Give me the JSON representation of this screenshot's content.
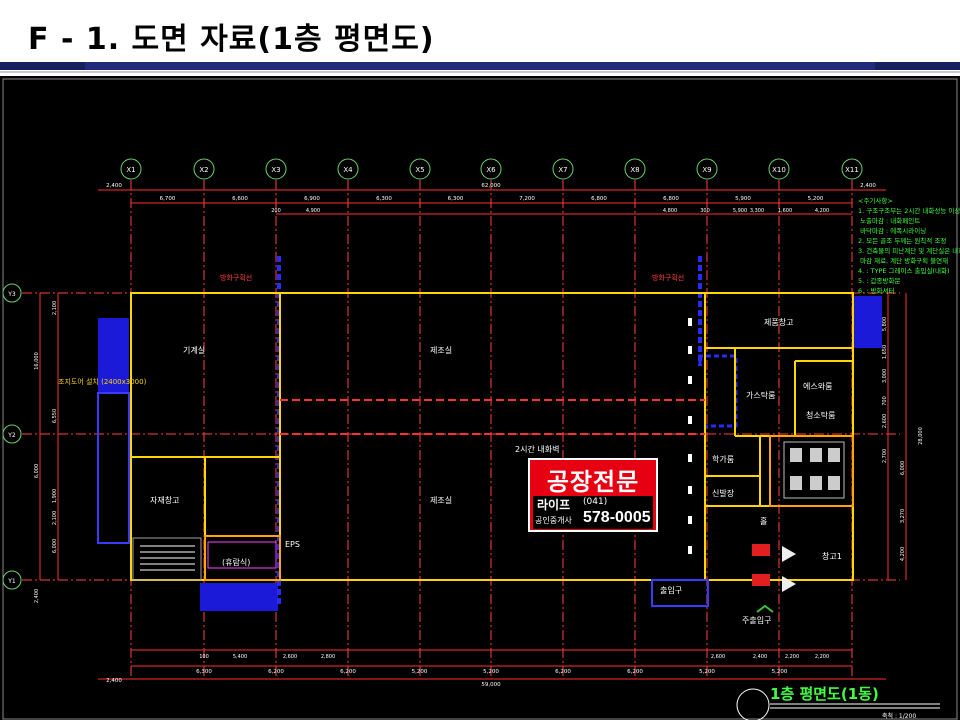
{
  "title": "F - 1. 도면 자료(1층 평면도)",
  "drawing_title": "1층 평면도(1동)",
  "scale_text": "축척 : 1/200",
  "grid_columns": [
    "X1",
    "X2",
    "X3",
    "X4",
    "X5",
    "X6",
    "X7",
    "X8",
    "X9",
    "X10",
    "X11"
  ],
  "grid_rows": [
    "Y3",
    "Y2",
    "Y1"
  ],
  "top_overall": "62,000",
  "bottom_overall": "59,000",
  "edge_left": "2,400",
  "edge_right": "2,400",
  "top_spans": [
    "6,700",
    "6,600",
    "6,900",
    "6,300",
    "6,300",
    "7,200",
    "6,800",
    "6,800",
    "5,900",
    "5,200"
  ],
  "top_sub": [
    "200",
    "4,900",
    "4,800",
    "300",
    "5,900",
    "3,300",
    "1,600",
    "4,200"
  ],
  "bottom_spans": [
    "6,300",
    "6,200",
    "6,200",
    "5,200",
    "5,200",
    "6,200",
    "6,200",
    "5,200",
    "5,200"
  ],
  "bottom_sub": [
    "100",
    "5,400",
    "2,600",
    "2,800",
    "2,600",
    "2,400",
    "2,200",
    "2,200"
  ],
  "right_dims": [
    "5,800",
    "1,650",
    "3,000",
    "700",
    "2,600",
    "2,700",
    "6,000",
    "3,270",
    "4,200",
    "28,000"
  ],
  "left_dims": [
    "2,100",
    "16,000",
    "6,000",
    "6,550",
    "1,900",
    "2,100",
    "6,000",
    "2,400"
  ],
  "rooms": {
    "machine": "기계실",
    "factory_top": "제조실",
    "factory_bottom": "제조실",
    "material_storage": "자재창고",
    "product_storage": "제품창고",
    "air_shower": "에스와룸",
    "gas_room": "가스탁룸",
    "eps": "EPS",
    "rest": "(휴람식)",
    "hall": "홀",
    "storage1": "창고1",
    "ramp": "주출입구",
    "room_a": "학가룸",
    "room_b": "신발장",
    "room_c": "청소탁룸",
    "wall_note": "2시간 내화벽",
    "firewall_left": "방화구획선",
    "firewall_right": "방화구획선",
    "side_note": "조지도어 설치 (2400x3000)",
    "ramp_small": "출입구"
  },
  "notes": {
    "heading": "<주기사항>",
    "lines": [
      "1. 구조구조부는 2시간 내화성능 이상",
      "   노출마감 : 내화페인트",
      "   바닥마감 : 에폭시라이닝",
      "2. 모든 골조 두께는 원칙적 조정",
      "3. 건축물의 피난계단 및 계단실은 내화",
      "   마감 재료, 계단 방화구획 불연재",
      "4. : TYPE 그레이스 출입실(내화)",
      "5. : 갑종방화문",
      "6. : 방화셔터"
    ]
  },
  "badge": {
    "main": "공장전문",
    "name": "라이프",
    "kind": "공인중개사",
    "area": "(041)",
    "phone": "578-0005"
  },
  "colors": {
    "title_rule": "#1f2a78",
    "drawing_bg": "#000000",
    "wall_yellow": "#ffd700",
    "dim_red": "#ff2020",
    "gridline": "#ff4040",
    "fire_blue": "#2626ff",
    "badge_red": "#e60012",
    "text_white": "#ffffff",
    "grid_bubble": "#6ad26a"
  }
}
